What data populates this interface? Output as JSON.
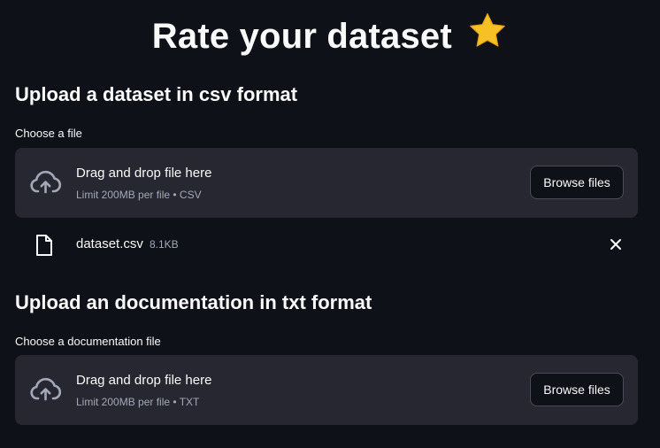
{
  "page": {
    "title": "Rate your dataset",
    "title_emoji": "star-icon"
  },
  "sections": [
    {
      "heading": "Upload a dataset in csv format",
      "label": "Choose a file",
      "dropzone": {
        "title": "Drag and drop file here",
        "subtitle": "Limit 200MB per file • CSV",
        "button": "Browse files"
      },
      "uploaded_file": {
        "name": "dataset.csv",
        "size": "8.1KB"
      }
    },
    {
      "heading": "Upload an documentation in txt format",
      "label": "Choose a documentation file",
      "dropzone": {
        "title": "Drag and drop file here",
        "subtitle": "Limit 200MB per file • TXT",
        "button": "Browse files"
      }
    }
  ],
  "colors": {
    "background": "#0e1117",
    "dropzone": "#262730",
    "star": "#f8c027"
  }
}
